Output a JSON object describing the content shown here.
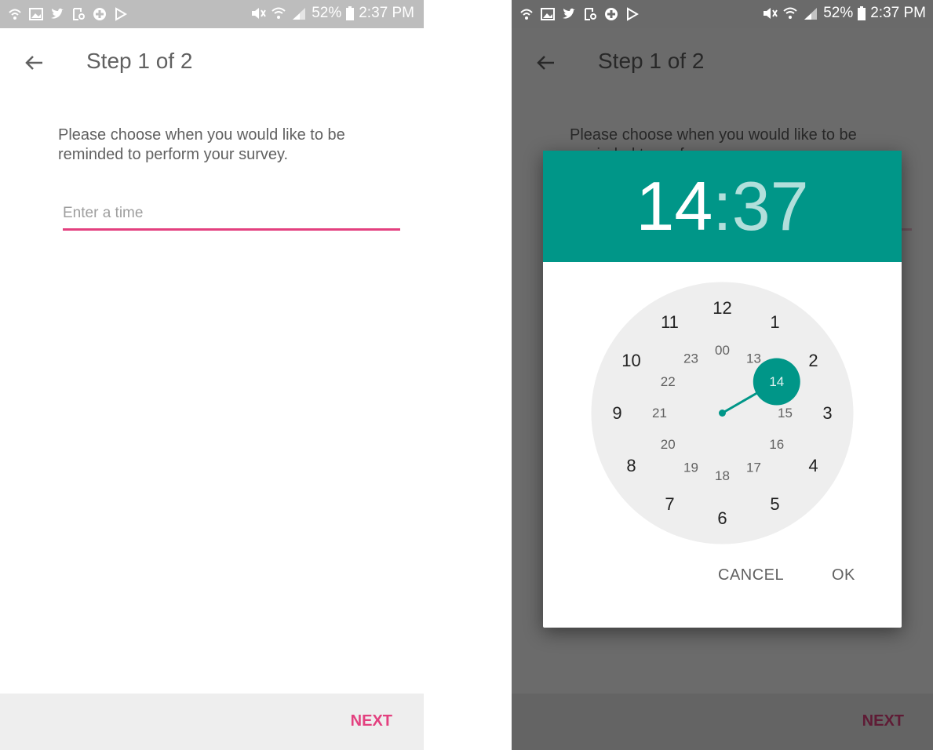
{
  "status_bar": {
    "battery": "52%",
    "time": "2:37 PM"
  },
  "appbar": {
    "title": "Step 1 of 2"
  },
  "content": {
    "prompt": "Please choose when you would like to be reminded to perform your survey.",
    "time_placeholder": "Enter a time"
  },
  "footer": {
    "next_label": "NEXT"
  },
  "time_picker": {
    "hour": "14",
    "separator": ":",
    "minute": "37",
    "selected_hour": "14",
    "outer_ring": [
      "12",
      "1",
      "2",
      "3",
      "4",
      "5",
      "6",
      "7",
      "8",
      "9",
      "10",
      "11"
    ],
    "inner_ring": [
      "00",
      "13",
      "14",
      "15",
      "16",
      "17",
      "18",
      "19",
      "20",
      "21",
      "22",
      "23"
    ],
    "cancel_label": "CANCEL",
    "ok_label": "OK"
  },
  "colors": {
    "accent": "#e3407f",
    "teal": "#009688",
    "teal_light": "#b2dfdb",
    "clock_face": "#eeeeee"
  },
  "icons": [
    "back-arrow-icon",
    "wifi-calling-icon",
    "gallery-icon",
    "twitter-icon",
    "phone-status-icon",
    "plus-icon",
    "play-store-icon",
    "mute-icon",
    "wifi-icon",
    "signal-icon",
    "battery-icon"
  ]
}
